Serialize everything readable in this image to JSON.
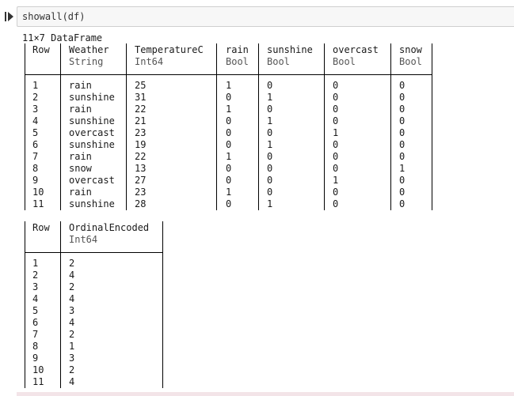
{
  "code_cell": {
    "code": "showall(df)"
  },
  "output": {
    "caption": "11×7 DataFrame",
    "table1": {
      "columns": [
        {
          "name": "Row",
          "type": ""
        },
        {
          "name": "Weather",
          "type": "String"
        },
        {
          "name": "TemperatureC",
          "type": "Int64"
        },
        {
          "name": "rain",
          "type": "Bool"
        },
        {
          "name": "sunshine",
          "type": "Bool"
        },
        {
          "name": "overcast",
          "type": "Bool"
        },
        {
          "name": "snow",
          "type": "Bool"
        }
      ],
      "rows": [
        [
          "1",
          "rain",
          "25",
          "1",
          "0",
          "0",
          "0"
        ],
        [
          "2",
          "sunshine",
          "31",
          "0",
          "1",
          "0",
          "0"
        ],
        [
          "3",
          "rain",
          "22",
          "1",
          "0",
          "0",
          "0"
        ],
        [
          "4",
          "sunshine",
          "21",
          "0",
          "1",
          "0",
          "0"
        ],
        [
          "5",
          "overcast",
          "23",
          "0",
          "0",
          "1",
          "0"
        ],
        [
          "6",
          "sunshine",
          "19",
          "0",
          "1",
          "0",
          "0"
        ],
        [
          "7",
          "rain",
          "22",
          "1",
          "0",
          "0",
          "0"
        ],
        [
          "8",
          "snow",
          "13",
          "0",
          "0",
          "0",
          "1"
        ],
        [
          "9",
          "overcast",
          "27",
          "0",
          "0",
          "1",
          "0"
        ],
        [
          "10",
          "rain",
          "23",
          "1",
          "0",
          "0",
          "0"
        ],
        [
          "11",
          "sunshine",
          "28",
          "0",
          "1",
          "0",
          "0"
        ]
      ]
    },
    "table2": {
      "columns": [
        {
          "name": "Row",
          "type": ""
        },
        {
          "name": "OrdinalEncoded",
          "type": "Int64"
        }
      ],
      "rows": [
        [
          "1",
          "2"
        ],
        [
          "2",
          "4"
        ],
        [
          "3",
          "2"
        ],
        [
          "4",
          "4"
        ],
        [
          "5",
          "3"
        ],
        [
          "6",
          "4"
        ],
        [
          "7",
          "2"
        ],
        [
          "8",
          "1"
        ],
        [
          "9",
          "3"
        ],
        [
          "10",
          "2"
        ],
        [
          "11",
          "4"
        ]
      ]
    }
  }
}
